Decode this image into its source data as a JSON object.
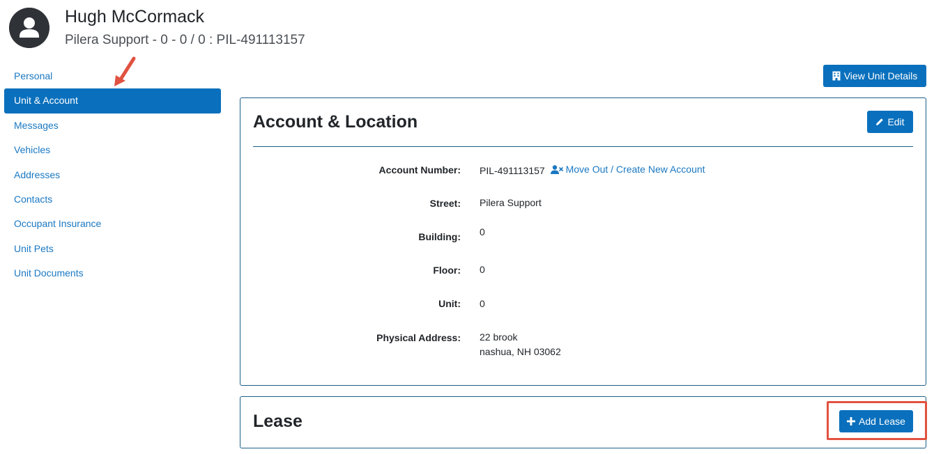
{
  "header": {
    "user_name": "Hugh McCormack",
    "subtitle": "Pilera Support - 0 - 0 / 0 : PIL-491113157",
    "avatar_icon": "user-avatar-icon"
  },
  "sidebar": {
    "items": [
      {
        "label": "Personal",
        "active": false
      },
      {
        "label": "Unit & Account",
        "active": true
      },
      {
        "label": "Messages",
        "active": false
      },
      {
        "label": "Vehicles",
        "active": false
      },
      {
        "label": "Addresses",
        "active": false
      },
      {
        "label": "Contacts",
        "active": false
      },
      {
        "label": "Occupant Insurance",
        "active": false
      },
      {
        "label": "Unit Pets",
        "active": false
      },
      {
        "label": "Unit Documents",
        "active": false
      }
    ]
  },
  "toolbar": {
    "view_unit_label": "View Unit Details",
    "view_unit_icon": "building-icon"
  },
  "account": {
    "title": "Account & Location",
    "edit_label": "Edit",
    "edit_icon": "pencil-icon",
    "fields": {
      "account_number": {
        "label": "Account Number:",
        "value": "PIL-491113157",
        "link": "Move Out / Create New Account",
        "link_icon": "user-remove-icon"
      },
      "street": {
        "label": "Street:",
        "value": "Pilera Support"
      },
      "building": {
        "label": "Building:",
        "value": "0"
      },
      "floor": {
        "label": "Floor:",
        "value": "0"
      },
      "unit": {
        "label": "Unit:",
        "value": "0"
      },
      "physical_address": {
        "label": "Physical Address:",
        "line1": "22 brook",
        "line2": "nashua, NH 03062"
      }
    }
  },
  "lease": {
    "title": "Lease",
    "add_label": "Add Lease",
    "add_icon": "plus-icon"
  },
  "annotations": {
    "arrow_color": "#e15240",
    "highlight_color": "#e15240"
  },
  "colors": {
    "primary": "#0a70bd",
    "link": "#1a78c2",
    "card_border": "#1b5f87"
  }
}
